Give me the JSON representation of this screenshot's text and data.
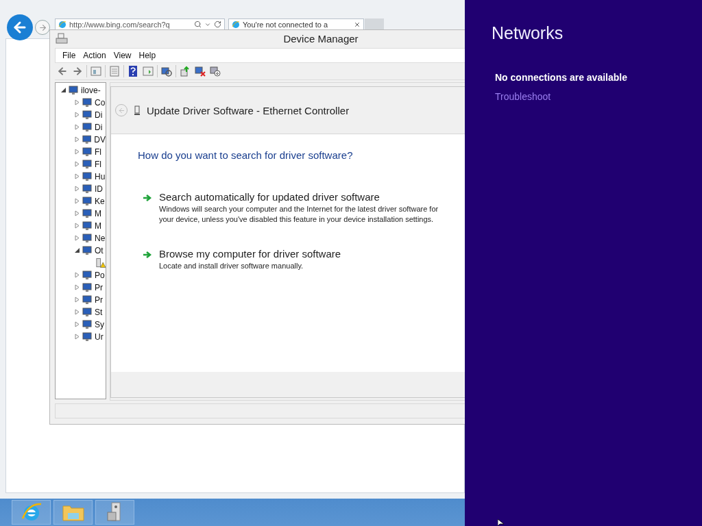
{
  "browser": {
    "address": "http://www.bing.com/search?q",
    "tab": {
      "title": "You're not connected to a"
    }
  },
  "device_manager": {
    "title": "Device Manager",
    "menu": [
      "File",
      "Action",
      "View",
      "Help"
    ],
    "tree": [
      {
        "label": "ilove-",
        "expanded": true,
        "children": [
          {
            "label": "Co",
            "expanded": false
          },
          {
            "label": "Di",
            "expanded": false
          },
          {
            "label": "Di",
            "expanded": false
          },
          {
            "label": "DV",
            "expanded": false
          },
          {
            "label": "Fl",
            "expanded": false
          },
          {
            "label": "Fl",
            "expanded": false
          },
          {
            "label": "Hu",
            "expanded": false
          },
          {
            "label": "ID",
            "expanded": false
          },
          {
            "label": "Ke",
            "expanded": false
          },
          {
            "label": "M",
            "expanded": false
          },
          {
            "label": "M",
            "expanded": false
          },
          {
            "label": "Ne",
            "expanded": false
          },
          {
            "label": "Ot",
            "expanded": true,
            "children": [
              {
                "kind": "device"
              }
            ]
          },
          {
            "label": "Po",
            "expanded": false
          },
          {
            "label": "Pr",
            "expanded": false
          },
          {
            "label": "Pr",
            "expanded": false
          },
          {
            "label": "St",
            "expanded": false
          },
          {
            "label": "Sy",
            "expanded": false
          },
          {
            "label": "Ur",
            "expanded": false
          }
        ]
      }
    ]
  },
  "wizard": {
    "title": "Update Driver Software - Ethernet Controller",
    "question": "How do you want to search for driver software?",
    "options": [
      {
        "title": "Search automatically for updated driver software",
        "description": "Windows will search your computer and the Internet for the latest driver software for your device, unless you've disabled this feature in your device installation settings."
      },
      {
        "title": "Browse my computer for driver software",
        "description": "Locate and install driver software manually."
      }
    ]
  },
  "networks": {
    "title": "Networks",
    "status": "No connections are available",
    "link": "Troubleshoot"
  },
  "taskbar": {
    "apps": [
      {
        "kind": "browser"
      },
      {
        "kind": "folder"
      },
      {
        "kind": "device-manager"
      }
    ]
  }
}
